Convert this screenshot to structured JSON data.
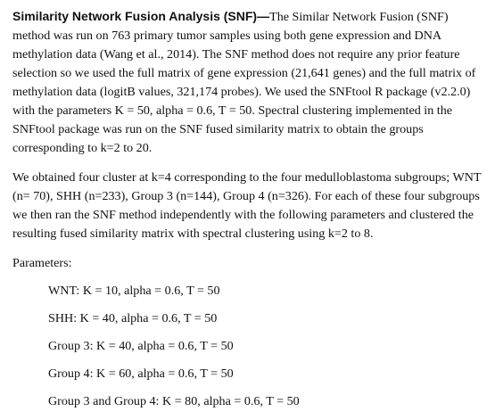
{
  "section": {
    "heading": "Similarity Network Fusion Analysis (SNF)—",
    "paragraph1_body": "The Similar Network Fusion (SNF) method was run on 763 primary tumor samples using both gene expression and DNA methylation data (Wang et al., 2014). The SNF method does not require any prior feature selection so we used the full matrix of gene expression (21,641 genes) and the full matrix of methylation data (logitB values, 321,174 probes). We used the SNFtool R package (v2.2.0) with the parameters K = 50, alpha = 0.6, T = 50. Spectral clustering implemented in the SNFtool package was run on the SNF fused similarity matrix to obtain the groups corresponding to k=2 to 20.",
    "paragraph2": "We obtained four cluster at k=4 corresponding to the four medulloblastoma subgroups; WNT (n= 70), SHH (n=233), Group 3 (n=144), Group 4 (n=326). For each of these four subgroups we then ran the SNF method independently with the following parameters and clustered the resulting fused similarity matrix with spectral clustering using k=2 to 8.",
    "parameters_label": "Parameters:",
    "parameters": [
      "WNT: K = 10, alpha = 0.6, T = 50",
      "SHH: K = 40, alpha = 0.6, T = 50",
      "Group 3: K = 40, alpha = 0.6, T = 50",
      "Group 4: K = 60, alpha = 0.6, T = 50",
      "Group 3 and Group 4: K = 80, alpha = 0.6, T = 50"
    ]
  }
}
